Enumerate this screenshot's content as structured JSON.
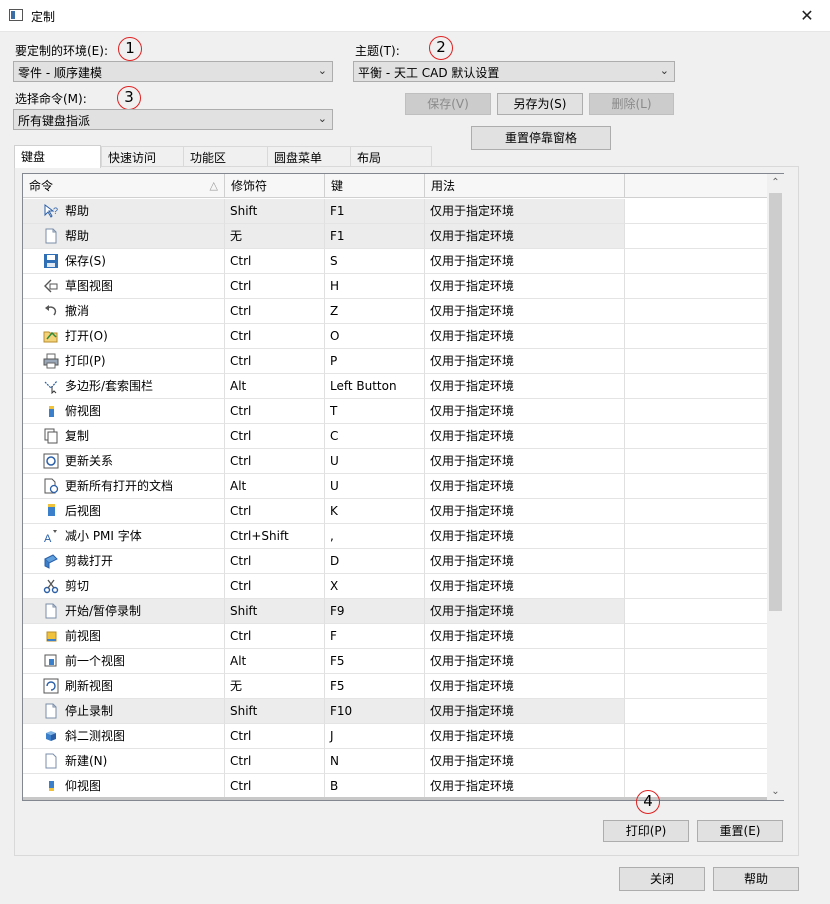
{
  "window": {
    "title": "定制",
    "close_glyph": "✕"
  },
  "environment": {
    "label": "要定制的环境(E):",
    "value": "零件 - 顺序建模"
  },
  "theme": {
    "label": "主题(T):",
    "value": "平衡 - 天工 CAD 默认设置"
  },
  "command_select": {
    "label": "选择命令(M):",
    "value": "所有键盘指派"
  },
  "buttons": {
    "save": "保存(V)",
    "save_as": "另存为(S)",
    "delete": "删除(L)",
    "reset_dock": "重置停靠窗格",
    "print": "打印(P)",
    "reset": "重置(E)",
    "close": "关闭",
    "help": "帮助"
  },
  "badges": {
    "b1": "1",
    "b2": "2",
    "b3": "3",
    "b4": "4"
  },
  "tabs": [
    "键盘",
    "快速访问",
    "功能区",
    "圆盘菜单",
    "布局"
  ],
  "table": {
    "columns": [
      "命令",
      "修饰符",
      "键",
      "用法"
    ],
    "rows": [
      {
        "cmd": "帮助",
        "mod": "Shift",
        "key": "F1",
        "usage": "仅用于指定环境",
        "icon": "help-pointer-icon",
        "hl": true
      },
      {
        "cmd": "帮助",
        "mod": "无",
        "key": "F1",
        "usage": "仅用于指定环境",
        "icon": "document-icon",
        "hl": true
      },
      {
        "cmd": "保存(S)",
        "mod": "Ctrl",
        "key": "S",
        "usage": "仅用于指定环境",
        "icon": "save-icon",
        "hl": false
      },
      {
        "cmd": "草图视图",
        "mod": "Ctrl",
        "key": "H",
        "usage": "仅用于指定环境",
        "icon": "sketch-view-icon",
        "hl": false
      },
      {
        "cmd": "撤消",
        "mod": "Ctrl",
        "key": "Z",
        "usage": "仅用于指定环境",
        "icon": "undo-icon",
        "hl": false
      },
      {
        "cmd": "打开(O)",
        "mod": "Ctrl",
        "key": "O",
        "usage": "仅用于指定环境",
        "icon": "open-icon",
        "hl": false
      },
      {
        "cmd": "打印(P)",
        "mod": "Ctrl",
        "key": "P",
        "usage": "仅用于指定环境",
        "icon": "print-icon",
        "hl": false
      },
      {
        "cmd": "多边形/套索围栏",
        "mod": "Alt",
        "key": "Left Button",
        "usage": "仅用于指定环境",
        "icon": "lasso-icon",
        "hl": false
      },
      {
        "cmd": "俯视图",
        "mod": "Ctrl",
        "key": "T",
        "usage": "仅用于指定环境",
        "icon": "top-view-icon",
        "hl": false
      },
      {
        "cmd": "复制",
        "mod": "Ctrl",
        "key": "C",
        "usage": "仅用于指定环境",
        "icon": "copy-icon",
        "hl": false
      },
      {
        "cmd": "更新关系",
        "mod": "Ctrl",
        "key": "U",
        "usage": "仅用于指定环境",
        "icon": "update-relations-icon",
        "hl": false
      },
      {
        "cmd": "更新所有打开的文档",
        "mod": "Alt",
        "key": "U",
        "usage": "仅用于指定环境",
        "icon": "update-documents-icon",
        "hl": false
      },
      {
        "cmd": "后视图",
        "mod": "Ctrl",
        "key": "K",
        "usage": "仅用于指定环境",
        "icon": "back-view-icon",
        "hl": false
      },
      {
        "cmd": "减小 PMI 字体",
        "mod": "Ctrl+Shift",
        "key": ",",
        "usage": "仅用于指定环境",
        "icon": "reduce-font-icon",
        "hl": false
      },
      {
        "cmd": "剪裁打开",
        "mod": "Ctrl",
        "key": "D",
        "usage": "仅用于指定环境",
        "icon": "clip-open-icon",
        "hl": false
      },
      {
        "cmd": "剪切",
        "mod": "Ctrl",
        "key": "X",
        "usage": "仅用于指定环境",
        "icon": "cut-icon",
        "hl": false
      },
      {
        "cmd": "开始/暂停录制",
        "mod": "Shift",
        "key": "F9",
        "usage": "仅用于指定环境",
        "icon": "document-icon",
        "hl": true
      },
      {
        "cmd": "前视图",
        "mod": "Ctrl",
        "key": "F",
        "usage": "仅用于指定环境",
        "icon": "front-view-icon",
        "hl": false
      },
      {
        "cmd": "前一个视图",
        "mod": "Alt",
        "key": "F5",
        "usage": "仅用于指定环境",
        "icon": "previous-view-icon",
        "hl": false
      },
      {
        "cmd": "刷新视图",
        "mod": "无",
        "key": "F5",
        "usage": "仅用于指定环境",
        "icon": "refresh-view-icon",
        "hl": false
      },
      {
        "cmd": "停止录制",
        "mod": "Shift",
        "key": "F10",
        "usage": "仅用于指定环境",
        "icon": "document-icon",
        "hl": true
      },
      {
        "cmd": "斜二测视图",
        "mod": "Ctrl",
        "key": "J",
        "usage": "仅用于指定环境",
        "icon": "dimetric-view-icon",
        "hl": false
      },
      {
        "cmd": "新建(N)",
        "mod": "Ctrl",
        "key": "N",
        "usage": "仅用于指定环境",
        "icon": "new-icon",
        "hl": false
      },
      {
        "cmd": "仰视图",
        "mod": "Ctrl",
        "key": "B",
        "usage": "仅用于指定环境",
        "icon": "bottom-view-icon",
        "hl": false
      }
    ]
  }
}
